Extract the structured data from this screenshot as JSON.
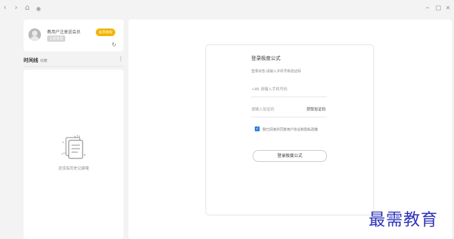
{
  "nav": {
    "back_icon": "‹",
    "forward_icon": "›",
    "home_icon": "⌂",
    "dot_icon": "◉"
  },
  "window": {
    "minimize_icon": "–",
    "maximize_icon": "▢",
    "close_icon": "✕"
  },
  "user": {
    "name": "教用户注册送会员",
    "tag": "立即登录",
    "vip_badge": "会员特权",
    "refresh_icon": "↻"
  },
  "timeline": {
    "title": "时间线",
    "subtitle": "收藏",
    "more_icon": "⋮",
    "empty_text": "还没有历史记录哦"
  },
  "login": {
    "title": "登录极度公式",
    "hint": "登录状态:请输入手机号和验证码",
    "phone_placeholder": "+86 请输入手机号码",
    "code_placeholder": "请输入验证码",
    "get_code_label": "获取验证码",
    "agree_text": "我已阅读并同意用户协议和隐私政策",
    "agree_checked": true,
    "button_label": "登录极度公式"
  },
  "watermark": "最需教育",
  "colors": {
    "accent": "#2f7fe0",
    "vip": "#f1b400",
    "watermark": "#2f35b8"
  }
}
